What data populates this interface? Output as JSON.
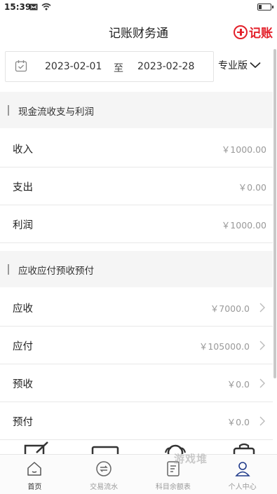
{
  "status_bar": {
    "time": "15:39"
  },
  "header": {
    "title": "记账财务通",
    "record_label": "记账"
  },
  "date_filter": {
    "start": "2023-02-01",
    "separator": "至",
    "end": "2023-02-28"
  },
  "version": {
    "label": "专业版"
  },
  "sections": [
    {
      "title": "现金流收支与利润",
      "rows": [
        {
          "label": "收入",
          "value": "￥1000.00"
        },
        {
          "label": "支出",
          "value": "￥0.00"
        },
        {
          "label": "利润",
          "value": "￥1000.00"
        }
      ]
    },
    {
      "title": "应收应付预收预付",
      "rows": [
        {
          "label": "应收",
          "value": "￥7000.0"
        },
        {
          "label": "应付",
          "value": "￥105000.0"
        },
        {
          "label": "预收",
          "value": "￥0.0"
        },
        {
          "label": "预付",
          "value": "￥0.0"
        }
      ]
    }
  ],
  "tabbar": {
    "items": [
      {
        "label": "首页",
        "icon": "home-icon"
      },
      {
        "label": "交易流水",
        "icon": "transfer-icon"
      },
      {
        "label": "科目余额表",
        "icon": "ledger-icon"
      },
      {
        "label": "个人中心",
        "icon": "user-icon"
      }
    ]
  },
  "watermark": "游戏堆",
  "colors": {
    "accent": "#e3202a",
    "section_bg": "#f5f5f5",
    "muted_text": "#999999"
  }
}
